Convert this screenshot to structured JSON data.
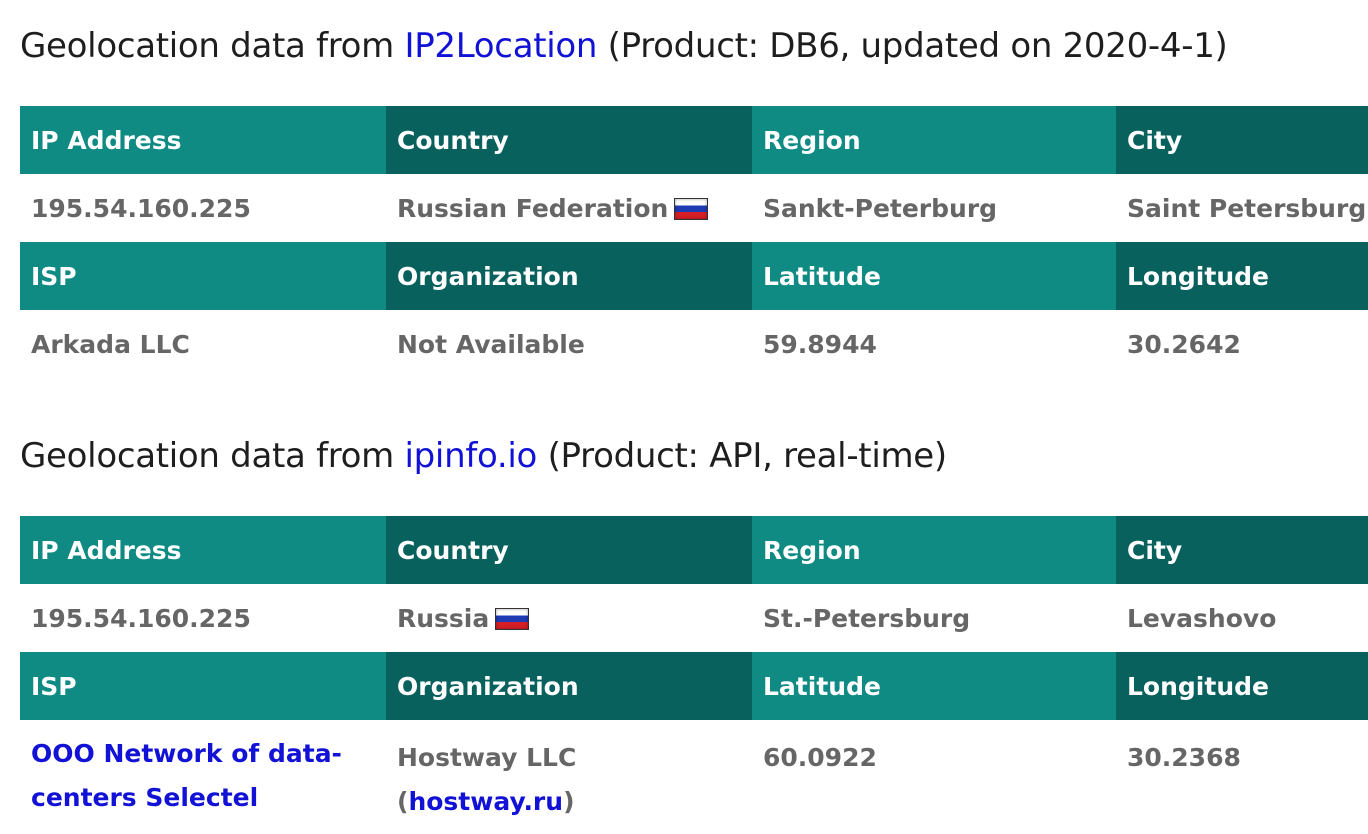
{
  "sections": [
    {
      "title_prefix": "Geolocation data from ",
      "provider_link": "IP2Location",
      "title_suffix": " (Product: DB6, updated on 2020-4-1)",
      "headers_row1": [
        "IP Address",
        "Country",
        "Region",
        "City"
      ],
      "row1": {
        "ip": "195.54.160.225",
        "country": "Russian Federation",
        "country_flag_icon": "russia-flag-icon",
        "region": "Sankt-Peterburg",
        "city": "Saint Petersburg"
      },
      "headers_row2": [
        "ISP",
        "Organization",
        "Latitude",
        "Longitude"
      ],
      "row2": {
        "isp": "Arkada LLC",
        "organization": "Not Available",
        "latitude": "59.8944",
        "longitude": "30.2642"
      }
    },
    {
      "title_prefix": "Geolocation data from ",
      "provider_link": "ipinfo.io",
      "title_suffix": " (Product: API, real-time)",
      "headers_row1": [
        "IP Address",
        "Country",
        "Region",
        "City"
      ],
      "row1": {
        "ip": "195.54.160.225",
        "country": "Russia",
        "country_flag_icon": "russia-flag-icon",
        "region": "St.-Petersburg",
        "city": "Levashovo"
      },
      "headers_row2": [
        "ISP",
        "Organization",
        "Latitude",
        "Longitude"
      ],
      "row2": {
        "isp_link": "OOO Network of data-centers Selectel",
        "organization_prefix": "Hostway LLC (",
        "organization_link": "hostway.ru",
        "organization_suffix": ")",
        "latitude": "60.0922",
        "longitude": "30.2368"
      }
    }
  ],
  "colors": {
    "header_light": "#0f8b83",
    "header_dark": "#08615d",
    "link": "#1212d6",
    "cell_text": "#666666"
  }
}
